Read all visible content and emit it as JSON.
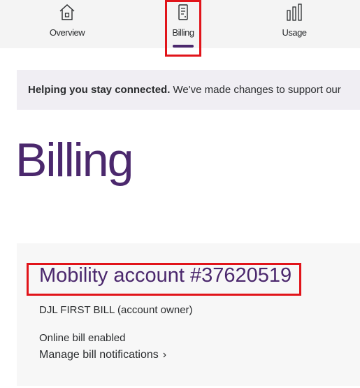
{
  "nav": {
    "items": [
      {
        "label": "Overview",
        "icon": "house-icon"
      },
      {
        "label": "Billing",
        "icon": "bill-icon",
        "active": true
      },
      {
        "label": "Usage",
        "icon": "bar-chart-icon"
      }
    ]
  },
  "banner": {
    "bold": "Helping you stay connected.",
    "text": " We've made changes to support our"
  },
  "page": {
    "title": "Billing"
  },
  "account": {
    "title": "Mobility account #37620519",
    "owner": "DJL FIRST BILL (account owner)",
    "bill_status": "Online bill enabled",
    "manage_link": "Manage bill notifications",
    "chevron": "›"
  },
  "colors": {
    "brand": "#4b286d",
    "highlight": "#e1141a",
    "nav_bg": "#f4f4f4",
    "banner_bg": "#f0eef3",
    "card_bg": "#f7f7f7"
  }
}
